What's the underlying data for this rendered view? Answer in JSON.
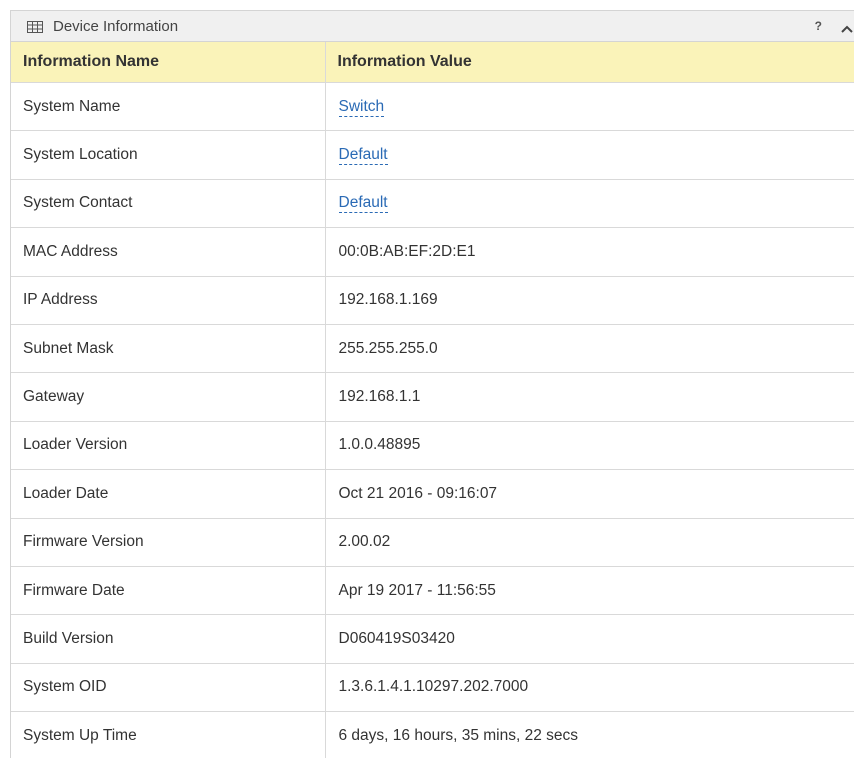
{
  "panel": {
    "title": "Device Information",
    "help_label": "?",
    "icon": "table-icon",
    "collapse_icon": "chevron-up-icon"
  },
  "table": {
    "headers": [
      "Information Name",
      "Information Value"
    ],
    "rows": [
      {
        "name": "System Name",
        "value": "Switch",
        "editable": true
      },
      {
        "name": "System Location",
        "value": "Default",
        "editable": true
      },
      {
        "name": "System Contact",
        "value": "Default",
        "editable": true
      },
      {
        "name": "MAC Address",
        "value": "00:0B:AB:EF:2D:E1",
        "editable": false
      },
      {
        "name": "IP Address",
        "value": "192.168.1.169",
        "editable": false
      },
      {
        "name": "Subnet Mask",
        "value": "255.255.255.0",
        "editable": false
      },
      {
        "name": "Gateway",
        "value": "192.168.1.1",
        "editable": false
      },
      {
        "name": "Loader Version",
        "value": "1.0.0.48895",
        "editable": false
      },
      {
        "name": "Loader Date",
        "value": "Oct 21 2016 - 09:16:07",
        "editable": false
      },
      {
        "name": "Firmware Version",
        "value": "2.00.02",
        "editable": false
      },
      {
        "name": "Firmware Date",
        "value": "Apr 19 2017 - 11:56:55",
        "editable": false
      },
      {
        "name": "Build Version",
        "value": "D060419S03420",
        "editable": false
      },
      {
        "name": "System OID",
        "value": "1.3.6.1.4.1.10297.202.7000",
        "editable": false
      },
      {
        "name": "System Up Time",
        "value": "6 days, 16 hours, 35 mins, 22 secs",
        "editable": false
      }
    ]
  },
  "colors": {
    "header_bg": "#f0f0f0",
    "table_header_bg": "#faf3b9",
    "link": "#2a6ab5",
    "border": "#d9d9d9"
  }
}
